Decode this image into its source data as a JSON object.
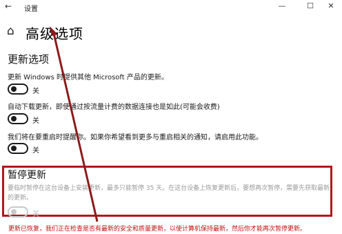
{
  "window": {
    "title": "设置",
    "back_icon": "arrow-left-icon",
    "minimize_icon": "minimize-icon",
    "maximize_icon": "maximize-icon",
    "close_icon": "close-icon"
  },
  "header": {
    "home_icon": "home-icon",
    "title": "高级选项"
  },
  "update_options": {
    "heading": "更新选项",
    "items": [
      {
        "label": "更新 Windows 时提供其他 Microsoft 产品的更新。",
        "state": "关",
        "on": false
      },
      {
        "label": "自动下载更新，即使通过按流量计费的数据连接也是如此(可能会收费)",
        "state": "关",
        "on": false
      },
      {
        "label": "我们将在要重启时提醒你。如果你希望看到更多与重启相关的通知，请启用此功能。",
        "state": "关",
        "on": false
      }
    ]
  },
  "pause_updates": {
    "heading": "暂停更新",
    "description": "要临时暂停在这台设备上安装更新，最多只能暂停 35 天。在这台设备上恢复更新后，要想再次暂停，需要先获取最新的更新。",
    "toggle_state": "关",
    "enabled": false
  },
  "annotation": {
    "note": "更新已恢复，我们正在检查是否有最新的安全和质量更新，以使计算机保持最新，然后你才能再次暂停更新。",
    "color": "#c01010",
    "arrow_color": "#8b1a1a"
  }
}
